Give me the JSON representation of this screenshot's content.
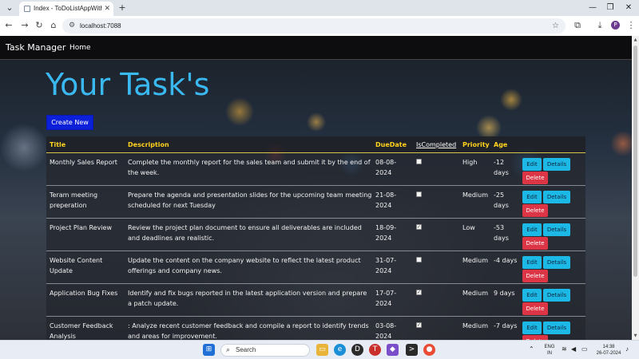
{
  "browser": {
    "tab_title": "Index - ToDoListAppWithDatab",
    "url": "localhost:7088",
    "profile_initial": "P"
  },
  "app": {
    "brand": "Task Manager",
    "nav": [
      "Home"
    ],
    "heading": "Your Task's",
    "create_label": "Create New"
  },
  "table": {
    "columns": [
      "Title",
      "Description",
      "DueDate",
      "IsCompleted",
      "Priority",
      "Age"
    ],
    "actions": {
      "edit": "Edit",
      "details": "Details",
      "delete": "Delete"
    },
    "rows": [
      {
        "title": "Monthly Sales Report",
        "description": "Complete the monthly report for the sales team and submit it by the end of the week.",
        "due": "08-08-2024",
        "completed": false,
        "priority": "High",
        "age": "-12 days"
      },
      {
        "title": "Teram meeting preperation",
        "description": "Prepare the agenda and presentation slides for the upcoming team meeting scheduled for next Tuesday",
        "due": "21-08-2024",
        "completed": false,
        "priority": "Medium",
        "age": "-25 days"
      },
      {
        "title": "Project Plan Review",
        "description": "Review the project plan document to ensure all deliverables are included and deadlines are realistic.",
        "due": "18-09-2024",
        "completed": true,
        "priority": "Low",
        "age": "-53 days"
      },
      {
        "title": "Website Content Update",
        "description": "Update the content on the company website to reflect the latest product offerings and company news.",
        "due": "31-07-2024",
        "completed": false,
        "priority": "Medium",
        "age": "-4 days"
      },
      {
        "title": "Application Bug Fixes",
        "description": "Identify and fix bugs reported in the latest application version and prepare a patch update.",
        "due": "17-07-2024",
        "completed": true,
        "priority": "Medium",
        "age": "9 days"
      },
      {
        "title": "Customer Feedback Analysis",
        "description": ": Analyze recent customer feedback and compile a report to identify trends and areas for improvement.",
        "due": "03-08-2024",
        "completed": true,
        "priority": "Medium",
        "age": "-7 days"
      }
    ]
  },
  "taskbar": {
    "search_label": "Search",
    "lang": "ENG",
    "region": "IN",
    "time": "14:38",
    "date": "26-07-2024"
  },
  "colors": {
    "heading": "#3ab8f0",
    "header_text": "#ffd21e",
    "create_button": "#0c1fd9",
    "info_button": "#1cb8e6",
    "danger_button": "#dc3545"
  }
}
